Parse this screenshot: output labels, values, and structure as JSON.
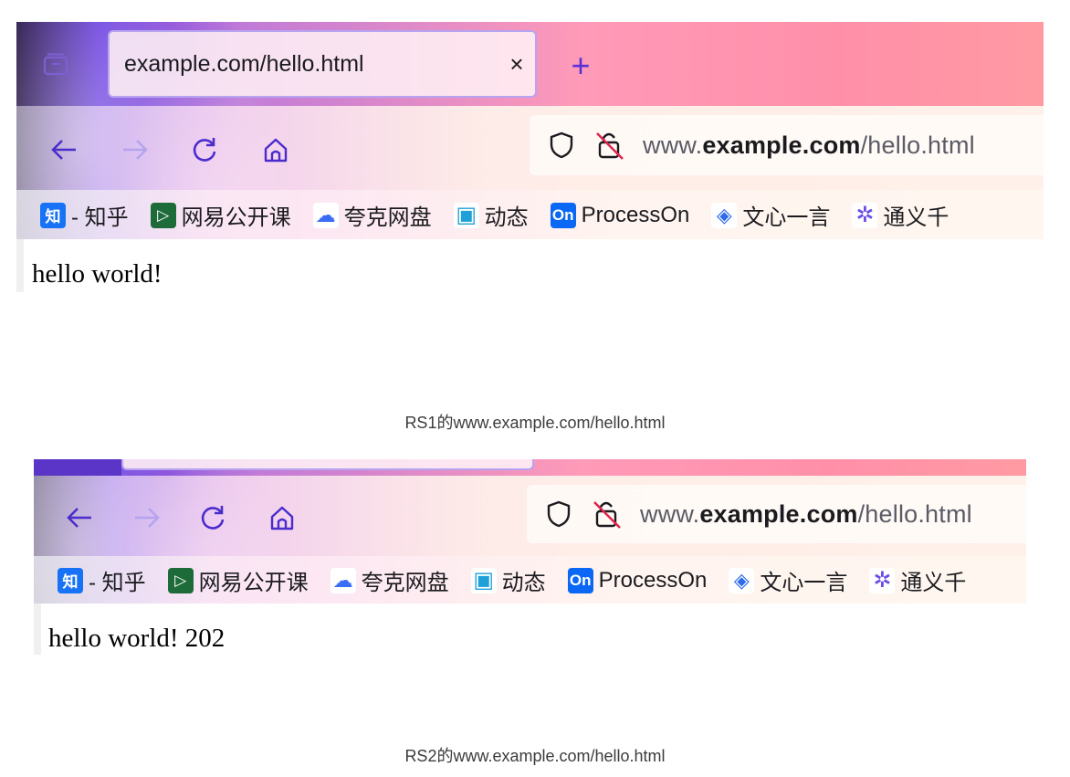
{
  "screenshots": [
    {
      "tab": {
        "title": "example.com/hello.html",
        "close_glyph": "×",
        "new_tab_glyph": "+"
      },
      "url": {
        "prefix": "www.",
        "domain": "example.com",
        "path": "/hello.html"
      },
      "bookmarks": [
        {
          "icon": "知",
          "label": "- 知乎",
          "color": "#1772f6"
        },
        {
          "icon": "▷",
          "label": "网易公开课",
          "color": "#1e6b3a"
        },
        {
          "icon": "☁",
          "label": "夸克网盘",
          "color": "#3b6cf5"
        },
        {
          "icon": "▣",
          "label": "动态",
          "color": "#20a0d8"
        },
        {
          "icon": "On",
          "label": "ProcessOn",
          "color": "#0a68f5"
        },
        {
          "icon": "◈",
          "label": "文心一言",
          "color": "#2f6be8"
        },
        {
          "icon": "✲",
          "label": "通义千",
          "color": "#6c4de6"
        }
      ],
      "content": "hello world!",
      "caption": "RS1的www.example.com/hello.html"
    },
    {
      "url": {
        "prefix": "www.",
        "domain": "example.com",
        "path": "/hello.html"
      },
      "bookmarks": [
        {
          "icon": "知",
          "label": "- 知乎",
          "color": "#1772f6"
        },
        {
          "icon": "▷",
          "label": "网易公开课",
          "color": "#1e6b3a"
        },
        {
          "icon": "☁",
          "label": "夸克网盘",
          "color": "#3b6cf5"
        },
        {
          "icon": "▣",
          "label": "动态",
          "color": "#20a0d8"
        },
        {
          "icon": "On",
          "label": "ProcessOn",
          "color": "#0a68f5"
        },
        {
          "icon": "◈",
          "label": "文心一言",
          "color": "#2f6be8"
        },
        {
          "icon": "✲",
          "label": "通义千",
          "color": "#6c4de6"
        }
      ],
      "content": "hello world! 202",
      "caption": "RS2的www.example.com/hello.html"
    }
  ]
}
